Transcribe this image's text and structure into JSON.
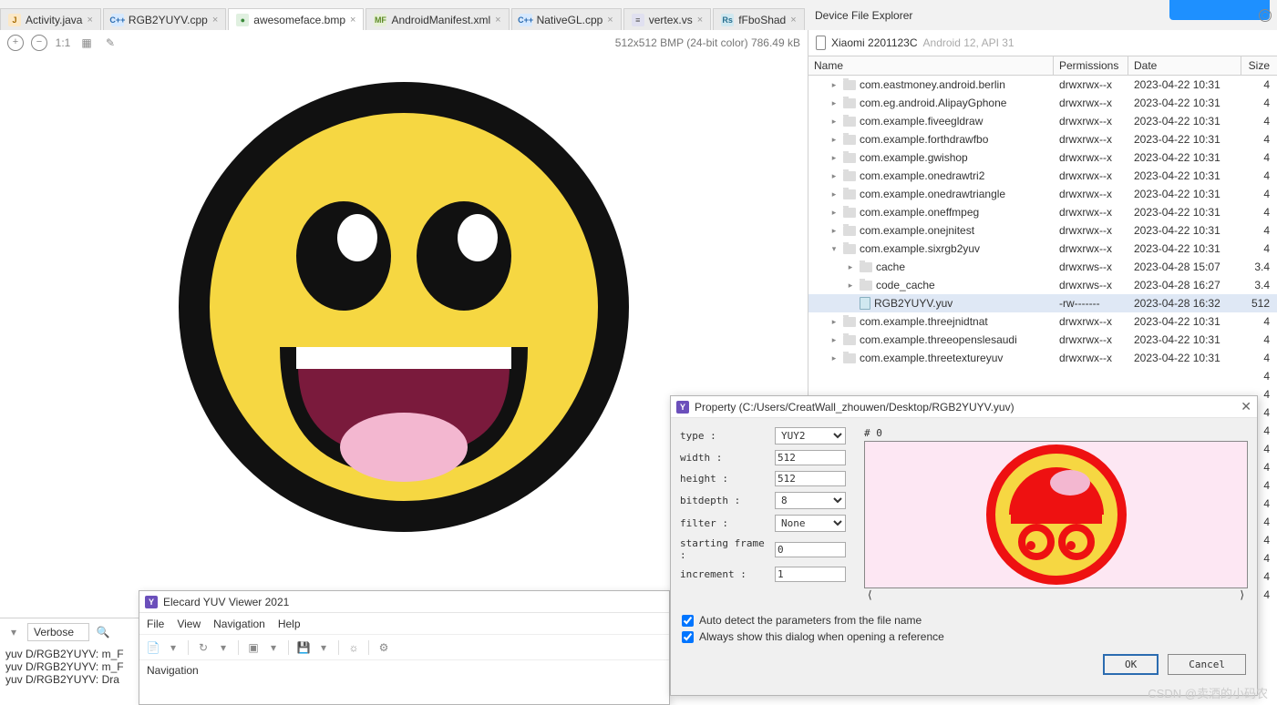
{
  "tabs": [
    {
      "icon": "J",
      "cls": "icn-java",
      "label": "Activity.java"
    },
    {
      "icon": "C++",
      "cls": "icn-cpp",
      "label": "RGB2YUYV.cpp"
    },
    {
      "icon": "●",
      "cls": "icn-bmp",
      "label": "awesomeface.bmp",
      "active": true
    },
    {
      "icon": "MF",
      "cls": "icn-mf",
      "label": "AndroidManifest.xml"
    },
    {
      "icon": "C++",
      "cls": "icn-cpp",
      "label": "NativeGL.cpp"
    },
    {
      "icon": "≡",
      "cls": "icn-vs",
      "label": "vertex.vs"
    },
    {
      "icon": "Rs",
      "cls": "icn-rs",
      "label": "fFboShad"
    }
  ],
  "explorer_title": "Device File Explorer",
  "device": {
    "name": "Xiaomi 2201123C",
    "detail": "Android 12, API 31"
  },
  "image_meta": "512x512 BMP (24-bit color) 786.49 kB",
  "imgbar": {
    "ratio": "1:1"
  },
  "columns": {
    "name": "Name",
    "perm": "Permissions",
    "date": "Date",
    "size": "Size"
  },
  "files": [
    {
      "d": 1,
      "a": "▸",
      "t": "f",
      "n": "com.eastmoney.android.berlin",
      "p": "drwxrwx--x",
      "dt": "2023-04-22 10:31",
      "s": "4"
    },
    {
      "d": 1,
      "a": "▸",
      "t": "f",
      "n": "com.eg.android.AlipayGphone",
      "p": "drwxrwx--x",
      "dt": "2023-04-22 10:31",
      "s": "4"
    },
    {
      "d": 1,
      "a": "▸",
      "t": "f",
      "n": "com.example.fiveegldraw",
      "p": "drwxrwx--x",
      "dt": "2023-04-22 10:31",
      "s": "4"
    },
    {
      "d": 1,
      "a": "▸",
      "t": "f",
      "n": "com.example.forthdrawfbo",
      "p": "drwxrwx--x",
      "dt": "2023-04-22 10:31",
      "s": "4"
    },
    {
      "d": 1,
      "a": "▸",
      "t": "f",
      "n": "com.example.gwishop",
      "p": "drwxrwx--x",
      "dt": "2023-04-22 10:31",
      "s": "4"
    },
    {
      "d": 1,
      "a": "▸",
      "t": "f",
      "n": "com.example.onedrawtri2",
      "p": "drwxrwx--x",
      "dt": "2023-04-22 10:31",
      "s": "4"
    },
    {
      "d": 1,
      "a": "▸",
      "t": "f",
      "n": "com.example.onedrawtriangle",
      "p": "drwxrwx--x",
      "dt": "2023-04-22 10:31",
      "s": "4"
    },
    {
      "d": 1,
      "a": "▸",
      "t": "f",
      "n": "com.example.oneffmpeg",
      "p": "drwxrwx--x",
      "dt": "2023-04-22 10:31",
      "s": "4"
    },
    {
      "d": 1,
      "a": "▸",
      "t": "f",
      "n": "com.example.onejnitest",
      "p": "drwxrwx--x",
      "dt": "2023-04-22 10:31",
      "s": "4"
    },
    {
      "d": 1,
      "a": "▾",
      "t": "f",
      "n": "com.example.sixrgb2yuv",
      "p": "drwxrwx--x",
      "dt": "2023-04-22 10:31",
      "s": "4"
    },
    {
      "d": 2,
      "a": "▸",
      "t": "f",
      "n": "cache",
      "p": "drwxrws--x",
      "dt": "2023-04-28 15:07",
      "s": "3.4"
    },
    {
      "d": 2,
      "a": "▸",
      "t": "f",
      "n": "code_cache",
      "p": "drwxrws--x",
      "dt": "2023-04-28 16:27",
      "s": "3.4"
    },
    {
      "d": 2,
      "a": "",
      "t": "i",
      "n": "RGB2YUYV.yuv",
      "p": "-rw-------",
      "dt": "2023-04-28 16:32",
      "s": "512",
      "sel": true
    },
    {
      "d": 1,
      "a": "▸",
      "t": "f",
      "n": "com.example.threejnidtnat",
      "p": "drwxrwx--x",
      "dt": "2023-04-22 10:31",
      "s": "4"
    },
    {
      "d": 1,
      "a": "▸",
      "t": "f",
      "n": "com.example.threeopenslesaudi",
      "p": "drwxrwx--x",
      "dt": "2023-04-22 10:31",
      "s": "4"
    },
    {
      "d": 1,
      "a": "▸",
      "t": "f",
      "n": "com.example.threetextureyuv",
      "p": "drwxrwx--x",
      "dt": "2023-04-22 10:31",
      "s": "4"
    },
    {
      "d": 1,
      "a": "",
      "t": "",
      "n": "",
      "p": "",
      "dt": "",
      "s": "4"
    },
    {
      "d": 1,
      "a": "",
      "t": "",
      "n": "",
      "p": "",
      "dt": "",
      "s": "4"
    },
    {
      "d": 1,
      "a": "",
      "t": "",
      "n": "",
      "p": "",
      "dt": "",
      "s": "4"
    },
    {
      "d": 1,
      "a": "",
      "t": "",
      "n": "",
      "p": "",
      "dt": "",
      "s": "4"
    },
    {
      "d": 1,
      "a": "",
      "t": "",
      "n": "",
      "p": "",
      "dt": "",
      "s": "4"
    },
    {
      "d": 1,
      "a": "",
      "t": "",
      "n": "",
      "p": "",
      "dt": "",
      "s": "4"
    },
    {
      "d": 1,
      "a": "",
      "t": "",
      "n": "",
      "p": "",
      "dt": "",
      "s": "4"
    },
    {
      "d": 1,
      "a": "",
      "t": "",
      "n": "",
      "p": "",
      "dt": "",
      "s": "4"
    },
    {
      "d": 1,
      "a": "",
      "t": "",
      "n": "",
      "p": "",
      "dt": "",
      "s": "4"
    },
    {
      "d": 1,
      "a": "",
      "t": "",
      "n": "",
      "p": "",
      "dt": "",
      "s": "4"
    },
    {
      "d": 1,
      "a": "",
      "t": "",
      "n": "",
      "p": "",
      "dt": "",
      "s": "4"
    },
    {
      "d": 1,
      "a": "",
      "t": "",
      "n": "",
      "p": "",
      "dt": "",
      "s": "4"
    },
    {
      "d": 1,
      "a": "",
      "t": "",
      "n": "",
      "p": "",
      "dt": "",
      "s": "4"
    }
  ],
  "log": {
    "level": "Verbose",
    "lines": [
      "yuv D/RGB2YUYV: m_F",
      "yuv D/RGB2YUYV: m_F",
      "yuv D/RGB2YUYV: Dra"
    ]
  },
  "yuv": {
    "title": "Elecard YUV Viewer 2021",
    "menu": [
      "File",
      "View",
      "Navigation",
      "Help"
    ],
    "bc": "Navigation"
  },
  "prop": {
    "title": "Property (C:/Users/CreatWall_zhouwen/Desktop/RGB2YUYV.yuv)",
    "labels": {
      "type": "type :",
      "width": "width :",
      "height": "height :",
      "bitdepth": "bitdepth :",
      "filter": "filter :",
      "sf": "starting frame :",
      "inc": "increment :"
    },
    "type": "YUY2",
    "width": "512",
    "height": "512",
    "bitdepth": "8",
    "filter": "None",
    "sf": "0",
    "inc": "1",
    "preview_label": "# 0",
    "chk1": "Auto detect the parameters from the file name",
    "chk2": "Always show this dialog when opening a reference",
    "ok": "OK",
    "cancel": "Cancel"
  },
  "watermark": "CSDN @卖酒的小码农"
}
